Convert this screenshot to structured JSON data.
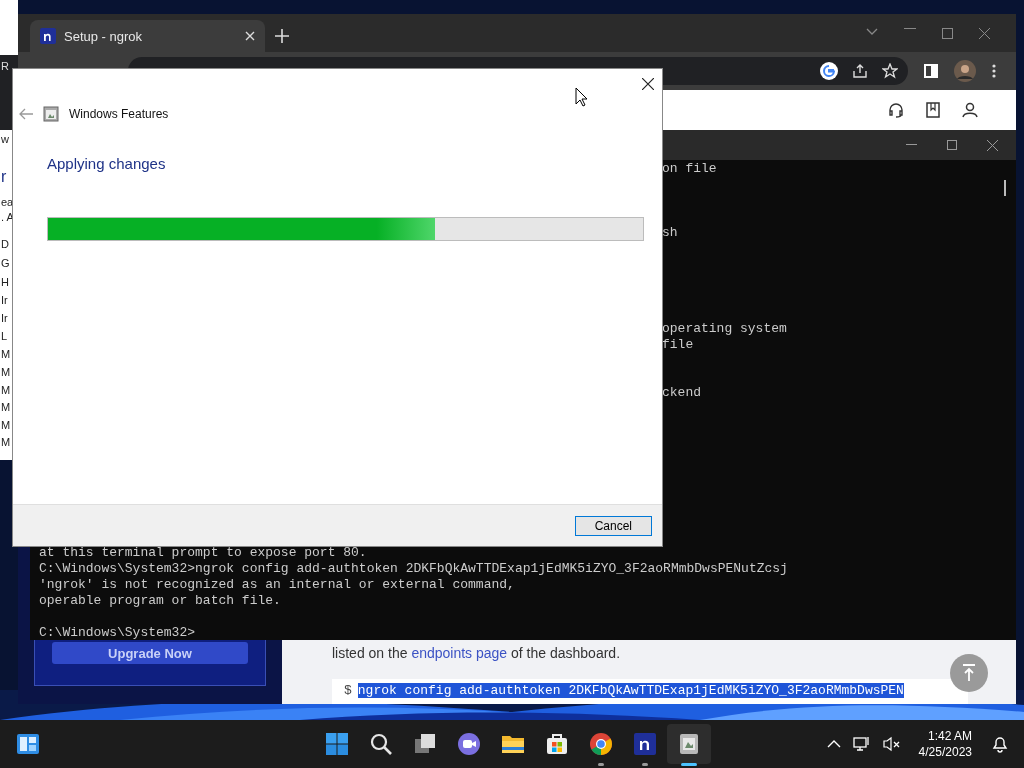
{
  "back_window": {
    "fragments": [
      "R",
      "w",
      "r",
      "ea",
      ". A",
      "D",
      "G",
      "H",
      "Ir",
      "Ir",
      "L",
      "M",
      "M",
      "M",
      "M",
      "M",
      "M"
    ]
  },
  "browser": {
    "tab": {
      "title": "Setup - ngrok",
      "selected": true
    },
    "sidebar": {
      "button": "Upgrade Now"
    },
    "content": {
      "text_before": "listed on the ",
      "link": "endpoints page",
      "text_after": " of the dashboard.",
      "prompt": "$",
      "command": "ngrok config add-authtoken 2DKFbQkAwTTDExap1jEdMK5iZYO_3F2aoRMmbDwsPEN"
    }
  },
  "terminal": {
    "hidden_lines": [
      "on file",
      "sh",
      "operating system",
      "file",
      "ckend"
    ],
    "lines": [
      "at this terminal prompt to expose port 80.",
      "C:\\Windows\\System32>ngrok config add-authtoken 2DKFbQkAwTTDExap1jEdMK5iZYO_3F2aoRMmbDwsPENutZcsj",
      "'ngrok' is not recognized as an internal or external command,",
      "operable program or batch file.",
      "C:\\Windows\\System32>"
    ]
  },
  "dialog": {
    "title": "Windows Features",
    "heading": "Applying changes",
    "progress": {
      "level": 0.65
    },
    "buttons": [
      "Cancel"
    ]
  },
  "taskbar": {
    "apps": [
      {
        "kind": "start",
        "running": false,
        "selected": false
      },
      {
        "kind": "search",
        "running": false,
        "selected": false
      },
      {
        "kind": "taskview",
        "running": false,
        "selected": false
      },
      {
        "kind": "chat",
        "running": false,
        "selected": false
      },
      {
        "kind": "explorer",
        "running": false,
        "selected": false
      },
      {
        "kind": "store",
        "running": false,
        "selected": false
      },
      {
        "kind": "chrome",
        "running": true,
        "selected": false
      },
      {
        "kind": "ngrok",
        "running": true,
        "selected": false
      },
      {
        "kind": "features",
        "running": true,
        "selected": true
      }
    ],
    "time": "1:42 AM",
    "date": "4/25/2023"
  }
}
